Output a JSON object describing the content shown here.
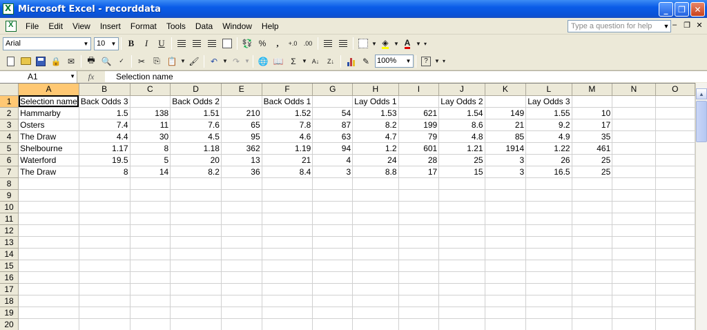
{
  "window": {
    "title": "Microsoft Excel - recorddata",
    "app_icon": "excel-icon",
    "controls": [
      "_",
      "❐",
      "✕"
    ]
  },
  "menu": {
    "items": [
      "File",
      "Edit",
      "View",
      "Insert",
      "Format",
      "Tools",
      "Data",
      "Window",
      "Help"
    ],
    "help_placeholder": "Type a question for help",
    "doc_controls": [
      "–",
      "❐",
      "✕"
    ]
  },
  "formatting": {
    "font": "Arial",
    "size": "10",
    "bold": "B",
    "italic": "I",
    "underline": "U",
    "percent": "%",
    "comma": ",",
    "inc_decimal": "+.0",
    "dec_decimal": ".00",
    "font_color_letter": "A"
  },
  "standard": {
    "zoom": "100%",
    "sigma": "Σ"
  },
  "formula_bar": {
    "cell_ref": "A1",
    "fx": "fx",
    "content": "Selection name"
  },
  "sheet": {
    "columns": [
      "A",
      "B",
      "C",
      "D",
      "E",
      "F",
      "G",
      "H",
      "I",
      "J",
      "K",
      "L",
      "M",
      "N",
      "O"
    ],
    "active_column": "A",
    "active_row": "1",
    "rows": [
      {
        "num": "1",
        "cells": [
          "Selection name",
          "Back Odds 3",
          "",
          "Back Odds 2",
          "",
          "Back Odds 1",
          "",
          "Lay Odds 1",
          "",
          "Lay Odds 2",
          "",
          "Lay Odds 3",
          "",
          "",
          ""
        ]
      },
      {
        "num": "2",
        "cells": [
          "Hammarby",
          "1.5",
          "138",
          "1.51",
          "210",
          "1.52",
          "54",
          "1.53",
          "621",
          "1.54",
          "149",
          "1.55",
          "10",
          "",
          ""
        ]
      },
      {
        "num": "3",
        "cells": [
          "Osters",
          "7.4",
          "11",
          "7.6",
          "65",
          "7.8",
          "87",
          "8.2",
          "199",
          "8.6",
          "21",
          "9.2",
          "17",
          "",
          ""
        ]
      },
      {
        "num": "4",
        "cells": [
          "The Draw",
          "4.4",
          "30",
          "4.5",
          "95",
          "4.6",
          "63",
          "4.7",
          "79",
          "4.8",
          "85",
          "4.9",
          "35",
          "",
          ""
        ]
      },
      {
        "num": "5",
        "cells": [
          "Shelbourne",
          "1.17",
          "8",
          "1.18",
          "362",
          "1.19",
          "94",
          "1.2",
          "601",
          "1.21",
          "1914",
          "1.22",
          "461",
          "",
          ""
        ]
      },
      {
        "num": "6",
        "cells": [
          "Waterford",
          "19.5",
          "5",
          "20",
          "13",
          "21",
          "4",
          "24",
          "28",
          "25",
          "3",
          "26",
          "25",
          "",
          ""
        ]
      },
      {
        "num": "7",
        "cells": [
          "The Draw",
          "8",
          "14",
          "8.2",
          "36",
          "8.4",
          "3",
          "8.8",
          "17",
          "15",
          "3",
          "16.5",
          "25",
          "",
          ""
        ]
      },
      {
        "num": "8",
        "cells": [
          "",
          "",
          "",
          "",
          "",
          "",
          "",
          "",
          "",
          "",
          "",
          "",
          "",
          "",
          ""
        ]
      },
      {
        "num": "9",
        "cells": [
          "",
          "",
          "",
          "",
          "",
          "",
          "",
          "",
          "",
          "",
          "",
          "",
          "",
          "",
          ""
        ]
      },
      {
        "num": "10",
        "cells": [
          "",
          "",
          "",
          "",
          "",
          "",
          "",
          "",
          "",
          "",
          "",
          "",
          "",
          "",
          ""
        ]
      },
      {
        "num": "11",
        "cells": [
          "",
          "",
          "",
          "",
          "",
          "",
          "",
          "",
          "",
          "",
          "",
          "",
          "",
          "",
          ""
        ]
      },
      {
        "num": "12",
        "cells": [
          "",
          "",
          "",
          "",
          "",
          "",
          "",
          "",
          "",
          "",
          "",
          "",
          "",
          "",
          ""
        ]
      },
      {
        "num": "13",
        "cells": [
          "",
          "",
          "",
          "",
          "",
          "",
          "",
          "",
          "",
          "",
          "",
          "",
          "",
          "",
          ""
        ]
      },
      {
        "num": "14",
        "cells": [
          "",
          "",
          "",
          "",
          "",
          "",
          "",
          "",
          "",
          "",
          "",
          "",
          "",
          "",
          ""
        ]
      },
      {
        "num": "15",
        "cells": [
          "",
          "",
          "",
          "",
          "",
          "",
          "",
          "",
          "",
          "",
          "",
          "",
          "",
          "",
          ""
        ]
      },
      {
        "num": "16",
        "cells": [
          "",
          "",
          "",
          "",
          "",
          "",
          "",
          "",
          "",
          "",
          "",
          "",
          "",
          "",
          ""
        ]
      },
      {
        "num": "17",
        "cells": [
          "",
          "",
          "",
          "",
          "",
          "",
          "",
          "",
          "",
          "",
          "",
          "",
          "",
          "",
          ""
        ]
      },
      {
        "num": "18",
        "cells": [
          "",
          "",
          "",
          "",
          "",
          "",
          "",
          "",
          "",
          "",
          "",
          "",
          "",
          "",
          ""
        ]
      },
      {
        "num": "19",
        "cells": [
          "",
          "",
          "",
          "",
          "",
          "",
          "",
          "",
          "",
          "",
          "",
          "",
          "",
          "",
          ""
        ]
      },
      {
        "num": "20",
        "cells": [
          "",
          "",
          "",
          "",
          "",
          "",
          "",
          "",
          "",
          "",
          "",
          "",
          "",
          "",
          ""
        ]
      }
    ]
  }
}
